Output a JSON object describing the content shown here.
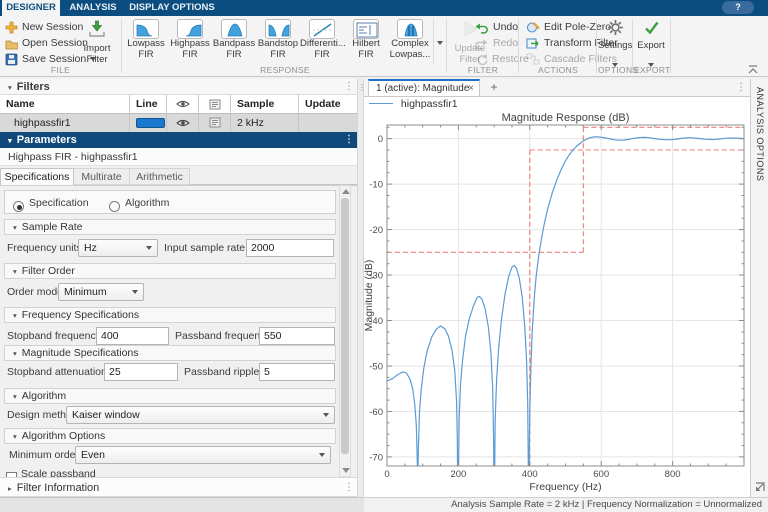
{
  "glyphs": {
    "kebab": "⋮",
    "close": "×",
    "add": "+",
    "help": "?",
    "collapse": "▾",
    "expand": "▸",
    "minimize": "▴"
  },
  "ribbon": {
    "tabs": [
      {
        "label": "DESIGNER"
      },
      {
        "label": "ANALYSIS"
      },
      {
        "label": "DISPLAY OPTIONS"
      }
    ],
    "file": {
      "label": "FILE",
      "new_session": "New Session",
      "open_session": "Open Session",
      "save_session": "Save Session",
      "import_line1": "Import",
      "import_line2": "Filter"
    },
    "response": {
      "label": "RESPONSE",
      "items": [
        {
          "line1": "Lowpass",
          "line2": "FIR"
        },
        {
          "line1": "Highpass",
          "line2": "FIR"
        },
        {
          "line1": "Bandpass",
          "line2": "FIR"
        },
        {
          "line1": "Bandstop",
          "line2": "FIR"
        },
        {
          "line1": "Differenti...",
          "line2": "FIR"
        },
        {
          "line1": "Hilbert FIR",
          "line2": ""
        },
        {
          "line1": "Complex",
          "line2": "Lowpas..."
        }
      ]
    },
    "filter": {
      "label": "FILTER",
      "update_line1": "Update",
      "update_line2": "Filter",
      "undo": "Undo",
      "redo": "Redo",
      "restore": "Restore"
    },
    "actions": {
      "label": "ACTIONS",
      "edit_pole_zero": "Edit Pole-Zero",
      "transform_filter": "Transform Filter",
      "cascade_filters": "Cascade Filters"
    },
    "options": {
      "label": "OPTIONS",
      "settings": "Settings"
    },
    "export": {
      "label": "EXPORT",
      "export": "Export"
    }
  },
  "filters_panel": {
    "title": "Filters",
    "columns": {
      "name": "Name",
      "line": "Line",
      "sample_rate": "Sample Rate",
      "update_status": "Update Status"
    },
    "rows": [
      {
        "name": "highpassfir1",
        "sample_rate": "2 kHz",
        "update_status": "",
        "line_color": "#1a78cf"
      }
    ]
  },
  "parameters_panel": {
    "title": "Parameters",
    "subtitle": "Highpass FIR - highpassfir1",
    "tabs": [
      {
        "label": "Specifications"
      },
      {
        "label": "Multirate"
      },
      {
        "label": "Arithmetic"
      }
    ],
    "design_mode": {
      "specification": "Specification",
      "algorithm": "Algorithm",
      "selected": "Specification"
    },
    "sample_rate": {
      "title": "Sample Rate",
      "frequency_units_label": "Frequency units",
      "frequency_units_value": "Hz",
      "input_sample_rate_label": "Input sample rate (Hz)",
      "input_sample_rate_value": "2000"
    },
    "filter_order": {
      "title": "Filter Order",
      "order_mode_label": "Order mode",
      "order_mode_value": "Minimum"
    },
    "frequency_specifications": {
      "title": "Frequency Specifications",
      "stopband_frequency_label": "Stopband frequency (Hz)",
      "stopband_frequency_value": "400",
      "passband_frequency_label": "Passband frequency (Hz)",
      "passband_frequency_value": "550"
    },
    "magnitude_specifications": {
      "title": "Magnitude Specifications",
      "stopband_attenuation_label": "Stopband attenuation (dB)",
      "stopband_attenuation_value": "25",
      "passband_ripple_label": "Passband ripple (dB)",
      "passband_ripple_value": "5"
    },
    "algorithm": {
      "title": "Algorithm",
      "design_method_label": "Design method",
      "design_method_value": "Kaiser window"
    },
    "algorithm_options": {
      "title": "Algorithm Options",
      "minimum_order_label": "Minimum order",
      "minimum_order_value": "Even",
      "scale_passband_label": "Scale passband",
      "scale_passband_checked": false
    },
    "filter_information": {
      "title": "Filter Information"
    }
  },
  "figure": {
    "tab_label": "1 (active): Magnitude",
    "legend_label": "highpassfir1",
    "analysis_options_label": "ANALYSIS OPTIONS",
    "status_bar": "Analysis Sample Rate = 2 kHz | Frequency Normalization = Unnormalized"
  },
  "chart_data": {
    "type": "line",
    "title": "Magnitude Response (dB)",
    "xlabel": "Frequency (Hz)",
    "ylabel": "Magnitude (dB)",
    "xlim": [
      0,
      1000
    ],
    "ylim": [
      -72,
      3
    ],
    "xticks": [
      0,
      200,
      400,
      600,
      800
    ],
    "yticks": [
      0,
      -10,
      -20,
      -30,
      -40,
      -50,
      -60,
      -70
    ],
    "x_minor_step": 50,
    "y_minor_step": 2.5,
    "grid": true,
    "legend_position": "top-left",
    "line_color": "#5b9bd5",
    "mask_color": "#ef8078",
    "grid_color": "#e4e4e4",
    "spec_mask": {
      "stopband_freq_hz": 400,
      "passband_freq_hz": 550,
      "stopband_atten_db": -25,
      "passband_upper_db": 2.5,
      "passband_lower_db": -2.5,
      "segments": [
        [
          [
            0,
            -25
          ],
          [
            550,
            -25
          ]
        ],
        [
          [
            550,
            2.5
          ],
          [
            550,
            -25
          ]
        ],
        [
          [
            550,
            2.5
          ],
          [
            1000,
            2.5
          ]
        ],
        [
          [
            400,
            -2.5
          ],
          [
            1000,
            -2.5
          ]
        ],
        [
          [
            400,
            -2.5
          ],
          [
            400,
            -72
          ]
        ]
      ]
    },
    "series": [
      {
        "name": "highpassfir1",
        "points": [
          [
            0,
            -53.3
          ],
          [
            15,
            -52.8
          ],
          [
            30,
            -51.9
          ],
          [
            45,
            -51.3
          ],
          [
            55,
            -51.6
          ],
          [
            65,
            -53.0
          ],
          [
            72,
            -55.0
          ],
          [
            78,
            -58.5
          ],
          [
            82,
            -63.0
          ],
          [
            85,
            -71.0
          ],
          [
            86,
            -76
          ],
          [
            88,
            -68
          ],
          [
            91,
            -60
          ],
          [
            96,
            -55
          ],
          [
            103,
            -50.5
          ],
          [
            112,
            -46.8
          ],
          [
            125,
            -43.7
          ],
          [
            138,
            -41.9
          ],
          [
            150,
            -41.2
          ],
          [
            162,
            -41.8
          ],
          [
            172,
            -43.4
          ],
          [
            182,
            -46.5
          ],
          [
            190,
            -51
          ],
          [
            195,
            -58
          ],
          [
            197,
            -66
          ],
          [
            198,
            -76
          ],
          [
            200,
            -76
          ],
          [
            202,
            -62
          ],
          [
            206,
            -54
          ],
          [
            212,
            -48.5
          ],
          [
            220,
            -43.5
          ],
          [
            230,
            -39.8
          ],
          [
            242,
            -36.8
          ],
          [
            252,
            -35.0
          ],
          [
            258,
            -34.7
          ],
          [
            266,
            -35.3
          ],
          [
            275,
            -37.5
          ],
          [
            284,
            -41.5
          ],
          [
            291,
            -47
          ],
          [
            296,
            -55
          ],
          [
            298.5,
            -66
          ],
          [
            299.5,
            -76
          ],
          [
            301,
            -76
          ],
          [
            303,
            -62
          ],
          [
            307,
            -53
          ],
          [
            313,
            -46
          ],
          [
            321,
            -39.5
          ],
          [
            331,
            -34
          ],
          [
            341,
            -30.3
          ],
          [
            350,
            -28.3
          ],
          [
            356,
            -27.9
          ],
          [
            363,
            -28.6
          ],
          [
            371,
            -30.8
          ],
          [
            379,
            -35
          ],
          [
            386,
            -41.5
          ],
          [
            391,
            -49
          ],
          [
            394,
            -58
          ],
          [
            395.5,
            -70
          ],
          [
            396.5,
            -76
          ],
          [
            398,
            -72
          ],
          [
            400,
            -60
          ],
          [
            403,
            -50
          ],
          [
            407,
            -42
          ],
          [
            412,
            -35.5
          ],
          [
            418,
            -30.2
          ],
          [
            425,
            -25.8
          ],
          [
            433,
            -21.8
          ],
          [
            442,
            -18.2
          ],
          [
            452,
            -14.9
          ],
          [
            463,
            -11.9
          ],
          [
            475,
            -9.2
          ],
          [
            487,
            -6.9
          ],
          [
            499,
            -5.0
          ],
          [
            511,
            -3.5
          ],
          [
            523,
            -2.3
          ],
          [
            535,
            -1.4
          ],
          [
            547,
            -0.7
          ],
          [
            558,
            -0.15
          ],
          [
            569,
            0.2
          ],
          [
            580,
            0.38
          ],
          [
            591,
            0.4
          ],
          [
            602,
            0.3
          ],
          [
            614,
            0.12
          ],
          [
            626,
            -0.08
          ],
          [
            638,
            -0.25
          ],
          [
            650,
            -0.35
          ],
          [
            662,
            -0.33
          ],
          [
            674,
            -0.2
          ],
          [
            686,
            -0.02
          ],
          [
            698,
            0.15
          ],
          [
            710,
            0.26
          ],
          [
            722,
            0.28
          ],
          [
            734,
            0.2
          ],
          [
            746,
            0.06
          ],
          [
            758,
            -0.08
          ],
          [
            771,
            -0.2
          ],
          [
            784,
            -0.26
          ],
          [
            797,
            -0.22
          ],
          [
            811,
            -0.1
          ],
          [
            825,
            0.05
          ],
          [
            838,
            0.17
          ],
          [
            851,
            0.2
          ],
          [
            864,
            0.12
          ],
          [
            878,
            0
          ],
          [
            892,
            -0.12
          ],
          [
            906,
            -0.2
          ],
          [
            920,
            -0.16
          ],
          [
            934,
            -0.05
          ],
          [
            948,
            0.07
          ],
          [
            962,
            0.14
          ],
          [
            976,
            0.12
          ],
          [
            989,
            0.05
          ],
          [
            1000,
            0
          ]
        ]
      }
    ]
  }
}
